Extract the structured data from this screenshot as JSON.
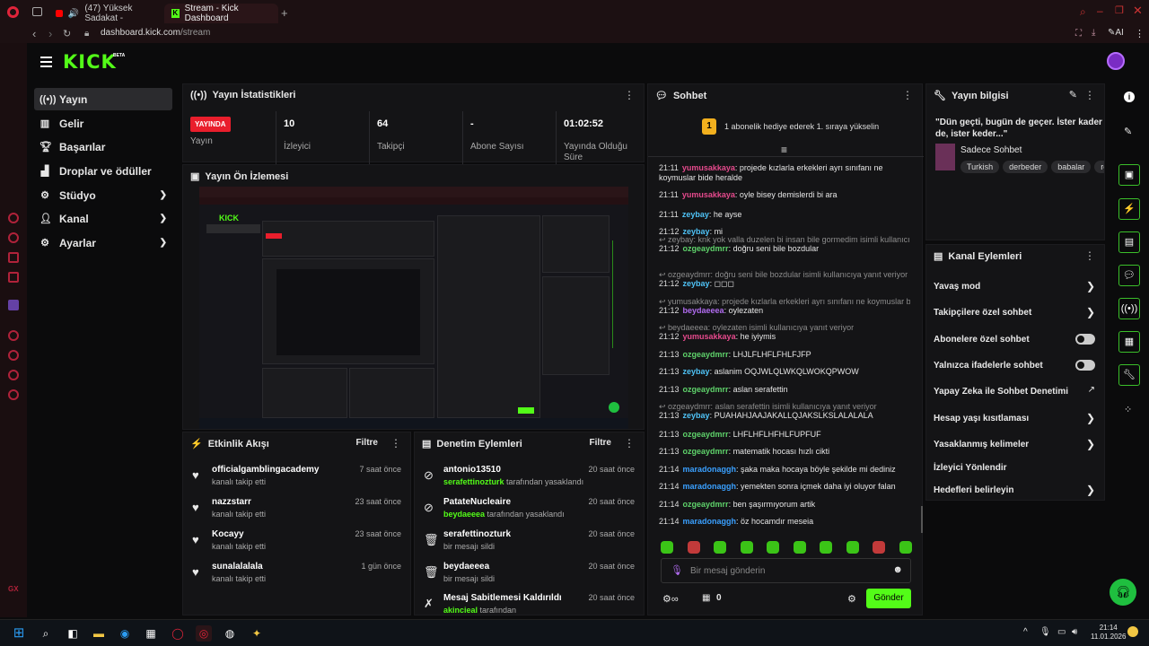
{
  "browser": {
    "tabs": [
      {
        "label": "(47) Yüksek Sadakat -"
      },
      {
        "label": "Stream - Kick Dashboard"
      }
    ],
    "url_host": "dashboard.kick.com",
    "url_path": "/stream",
    "ai_label": "AI"
  },
  "header": {
    "logo": "KICK",
    "beta": "BETA"
  },
  "nav": {
    "items": [
      {
        "label": "Yayın",
        "icon": "broadcast-icon"
      },
      {
        "label": "Gelir",
        "icon": "revenue-icon"
      },
      {
        "label": "Başarılar",
        "icon": "trophy-icon"
      },
      {
        "label": "Droplar ve ödüller",
        "icon": "drops-icon"
      },
      {
        "label": "Stüdyo",
        "icon": "studio-icon"
      },
      {
        "label": "Kanal",
        "icon": "channel-icon"
      },
      {
        "label": "Ayarlar",
        "icon": "settings-icon"
      }
    ]
  },
  "stats": {
    "title": "Yayın İstatistikleri",
    "live": "YAYINDA",
    "live_label": "Yayın",
    "viewers": "10",
    "viewers_label": "İzleyici",
    "followers": "64",
    "followers_label": "Takipçi",
    "subs": "-",
    "subs_label": "Abone Sayısı",
    "uptime": "01:02:52",
    "uptime_label": "Yayında Olduğu Süre"
  },
  "preview": {
    "title": "Yayın Ön İzlemesi"
  },
  "activity": {
    "title": "Etkinlik Akışı",
    "filter": "Filtre",
    "items": [
      {
        "name": "officialgamblingacademy",
        "sub": "kanalı takip etti",
        "time": "7 saat önce"
      },
      {
        "name": "nazzstarr",
        "sub": "kanalı takip etti",
        "time": "23 saat önce"
      },
      {
        "name": "Kocayy",
        "sub": "kanalı takip etti",
        "time": "23 saat önce"
      },
      {
        "name": "sunalalalala",
        "sub": "kanalı takip etti",
        "time": "1 gün önce"
      }
    ]
  },
  "moderation": {
    "title": "Denetim Eylemleri",
    "filter": "Filtre",
    "items": [
      {
        "name": "antonio13510",
        "by": "serafettinozturk",
        "rest": " tarafından yasaklandı",
        "time": "20 saat önce",
        "icon": "ban-icon"
      },
      {
        "name": "PatateNucleaire",
        "by": "beydaeeea",
        "rest": " tarafından yasaklandı",
        "time": "20 saat önce",
        "icon": "ban-icon"
      },
      {
        "name": "serafettinozturk",
        "by": "",
        "rest": "bir mesajı sildi",
        "time": "20 saat önce",
        "icon": "trash-icon"
      },
      {
        "name": "beydaeeea",
        "by": "",
        "rest": "bir mesajı sildi",
        "time": "20 saat önce",
        "icon": "trash-icon"
      },
      {
        "name": "Mesaj Sabitlemesi Kaldırıldı",
        "by": "akincieal",
        "rest": " tarafından",
        "time": "20 saat önce",
        "icon": "unpin-icon"
      }
    ]
  },
  "chat": {
    "title": "Sohbet",
    "gift_text": "1 abonelik hediye ederek 1. sıraya yükselin",
    "gift_rank": "1",
    "placeholder": "Bir mesaj gönderin",
    "send": "Gönder",
    "count": "0",
    "lines": [
      {
        "t": "21:11",
        "u": "yumusakkaya",
        "c": "u1",
        "m": ": projede kızlarla erkekleri ayrı sınıfanı ne koymuslar bide heralde",
        "r": ""
      },
      {
        "t": "21:11",
        "u": "yumusakkaya",
        "c": "u1",
        "m": ": oyle bisey demislerdi bi ara",
        "r": ""
      },
      {
        "t": "21:11",
        "u": "zeybay",
        "c": "u2",
        "m": ": he ayse",
        "r": ""
      },
      {
        "t": "21:12",
        "u": "zeybay",
        "c": "u2",
        "m": ": mi",
        "r": ""
      },
      {
        "t": "21:12",
        "u": "ozgeaydmrr",
        "c": "u3",
        "m": ": doğru seni bile bozdular",
        "r": "↩ zeybay: knk yok valla duzelen bi insan bile gormedim isimli kullanıcı..."
      },
      {
        "t": "21:12",
        "u": "zeybay",
        "c": "u2",
        "m": ": ◻◻◻",
        "r": "↩ ozgeaydmrr: doğru seni bile bozdular isimli kullanıcıya yanıt veriyor"
      },
      {
        "t": "21:12",
        "u": "beydaeeea",
        "c": "u4",
        "m": ": oylezaten",
        "r": "↩ yumusakkaya: projede kızlarla erkekleri ayrı sınıfanı ne koymuslar b..."
      },
      {
        "t": "21:12",
        "u": "yumusakkaya",
        "c": "u1",
        "m": ": he iyiymis",
        "r": "↩ beydaeeea: oylezaten isimli kullanıcıya yanıt veriyor"
      },
      {
        "t": "21:13",
        "u": "ozgeaydmrr",
        "c": "u3",
        "m": ": LHJLFLHFLFHLFJFP",
        "r": ""
      },
      {
        "t": "21:13",
        "u": "zeybay",
        "c": "u2",
        "m": ": aslanim OQJWLQLWKQLWOKQPWOW",
        "r": ""
      },
      {
        "t": "21:13",
        "u": "ozgeaydmrr",
        "c": "u3",
        "m": ": aslan serafettin",
        "r": ""
      },
      {
        "t": "21:13",
        "u": "zeybay",
        "c": "u2",
        "m": ": PUAHAHJAAJAKALLQJAKSLKSLALALALA",
        "r": "↩ ozgeaydmrr: aslan serafettin isimli kullanıcıya yanıt veriyor"
      },
      {
        "t": "21:13",
        "u": "ozgeaydmrr",
        "c": "u3",
        "m": ": LHFLHFLHFHLFUPFUF",
        "r": ""
      },
      {
        "t": "21:13",
        "u": "ozgeaydmrr",
        "c": "u3",
        "m": ": matematik hocası hızlı cikti",
        "r": ""
      },
      {
        "t": "21:14",
        "u": "maradonaggh",
        "c": "u5",
        "m": ": şaka maka hocaya böyle şekilde mi dediniz",
        "r": ""
      },
      {
        "t": "21:14",
        "u": "maradonaggh",
        "c": "u5",
        "m": ": yemekten sonra içmek daha iyi oluyor falan",
        "r": ""
      },
      {
        "t": "21:14",
        "u": "ozgeaydmrr",
        "c": "u3",
        "m": ": ben şaşırmıyorum artik",
        "r": ""
      },
      {
        "t": "21:14",
        "u": "maradonaggh",
        "c": "u5",
        "m": ": öz hocamdır meseia",
        "r": ""
      }
    ]
  },
  "info": {
    "title": "Yayın bilgisi",
    "stream_title": "\"Dün geçti, bugün de geçer. İster kader de, ister keder...\"",
    "category": "Sadece Sohbet",
    "tags": [
      "Turkish",
      "derbeder",
      "babalar",
      "re"
    ]
  },
  "channel_actions": {
    "title": "Kanal Eylemleri",
    "items": [
      {
        "label": "Yavaş mod",
        "type": "arrow"
      },
      {
        "label": "Takipçilere özel sohbet",
        "type": "arrow"
      },
      {
        "label": "Abonelere özel sohbet",
        "type": "toggle"
      },
      {
        "label": "Yalnızca ifadelerle sohbet",
        "type": "toggle"
      },
      {
        "label": "Yapay Zeka ile Sohbet Denetimi",
        "type": "ext"
      },
      {
        "label": "Hesap yaşı kısıtlaması",
        "type": "arrow"
      },
      {
        "label": "Yasaklanmış kelimeler",
        "type": "arrow"
      },
      {
        "label": "İzleyici Yönlendir",
        "type": "none"
      },
      {
        "label": "Hedefleri belirleyin",
        "type": "arrow"
      }
    ]
  },
  "taskbar": {
    "time": "21:14",
    "date": "11.01.2026"
  },
  "colors": {
    "accent": "#53fc18",
    "live": "#e91e2c",
    "opera": "#b0223a"
  }
}
